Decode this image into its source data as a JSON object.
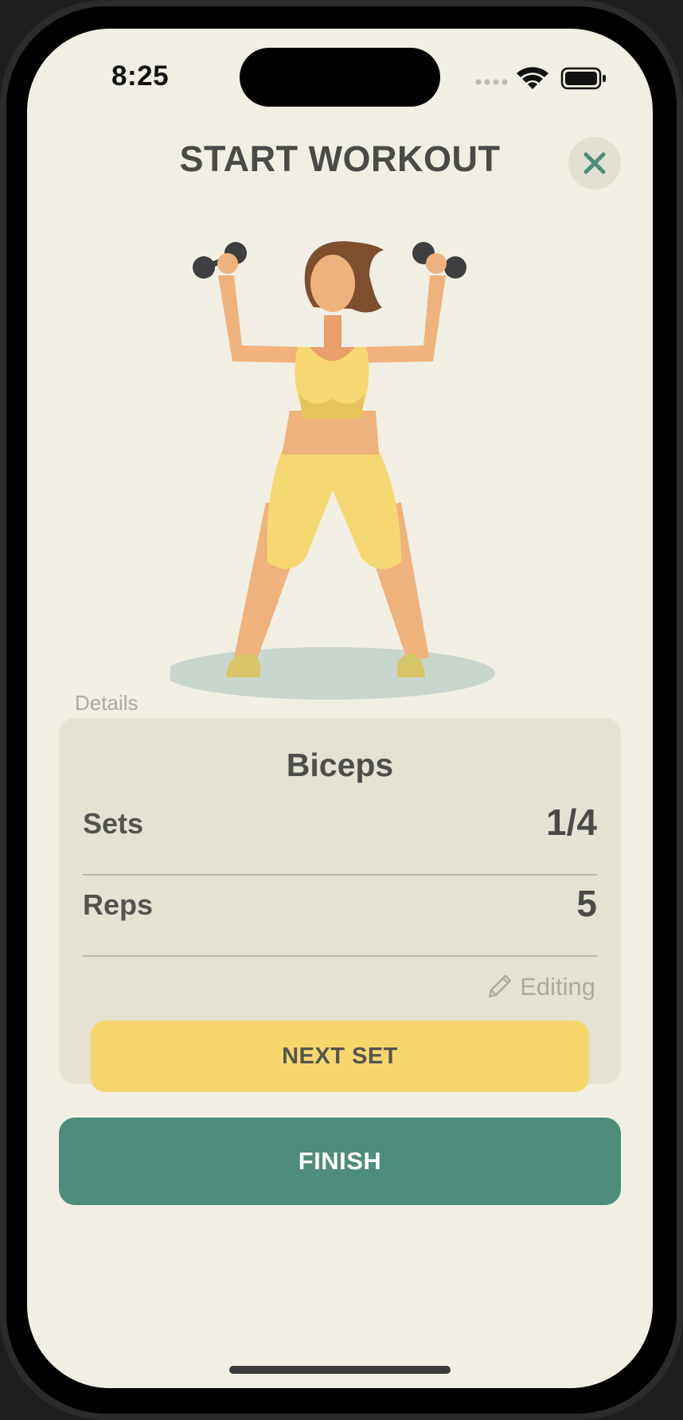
{
  "status_bar": {
    "time": "8:25"
  },
  "header": {
    "title": "START WORKOUT"
  },
  "details": {
    "section_label": "Details",
    "exercise_name": "Biceps",
    "sets_label": "Sets",
    "sets_value": "1/4",
    "reps_label": "Reps",
    "reps_value": "5",
    "editing_label": "Editing",
    "next_set_label": "NEXT SET"
  },
  "finish_label": "FINISH",
  "colors": {
    "background": "#f1efe3",
    "card": "#e5e2d4",
    "accent_yellow": "#f5d76e",
    "accent_green": "#4e8c7b",
    "text_dark": "#4a4a48"
  },
  "icons": [
    "wifi-icon",
    "battery-icon",
    "cellular-icon",
    "close-icon",
    "pencil-icon"
  ]
}
